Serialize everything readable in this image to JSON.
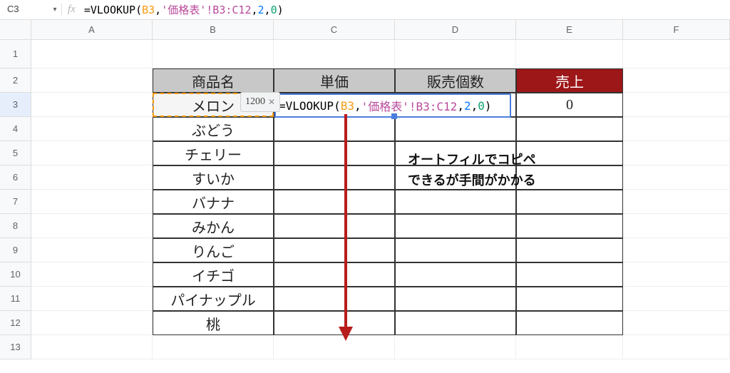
{
  "namebox": "C3",
  "formula": {
    "prefix": "=VLOOKUP(",
    "arg1": "B3",
    "sep": ",",
    "arg2": "'価格表'!B3:C12",
    "arg3": "2",
    "arg4": "0",
    "suffix": ")"
  },
  "cols": [
    "A",
    "B",
    "C",
    "D",
    "E",
    "F"
  ],
  "rownums": [
    1,
    2,
    3,
    4,
    5,
    6,
    7,
    8,
    9,
    10,
    11,
    12,
    13
  ],
  "activeRow": 3,
  "header": {
    "b": "商品名",
    "c": "単価",
    "d": "販売個数",
    "e": "売上"
  },
  "items": [
    "メロン",
    "ぶどう",
    "チェリー",
    "すいか",
    "バナナ",
    "みかん",
    "りんご",
    "イチゴ",
    "パイナップル",
    "桃"
  ],
  "e3": "0",
  "preview": "1200",
  "annotation": {
    "l1": "オートフィルでコピペ",
    "l2": "できるが手間がかかる"
  }
}
